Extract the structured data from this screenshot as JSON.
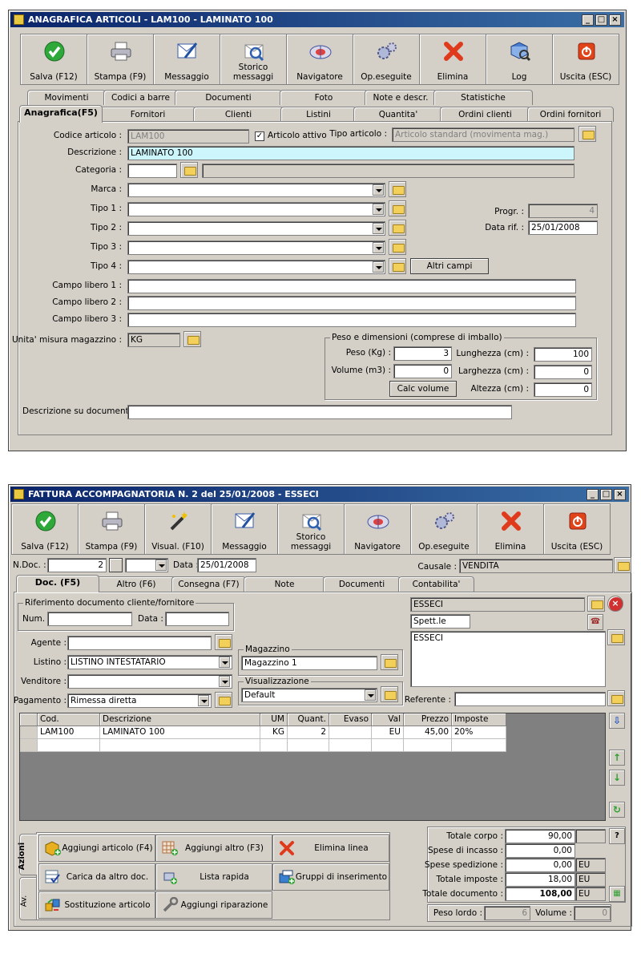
{
  "win1": {
    "title": "ANAGRAFICA ARTICOLI - LAM100 - LAMINATO 100",
    "toolbar": [
      {
        "label": "Salva (F12)",
        "icon": "check-icon"
      },
      {
        "label": "Stampa (F9)",
        "icon": "printer-icon"
      },
      {
        "label": "Messaggio",
        "icon": "message-icon"
      },
      {
        "label": "Storico messaggi",
        "icon": "message-history-icon"
      },
      {
        "label": "Navigatore",
        "icon": "navigator-icon"
      },
      {
        "label": "Op.eseguite",
        "icon": "operations-icon"
      },
      {
        "label": "Elimina",
        "icon": "delete-icon"
      },
      {
        "label": "Log",
        "icon": "log-icon"
      },
      {
        "label": "Uscita (ESC)",
        "icon": "exit-icon"
      }
    ],
    "tabs_top": [
      "Movimenti",
      "Codici a barre",
      "Documenti",
      "Foto",
      "Note e descr.",
      "Statistiche"
    ],
    "tabs_bottom": [
      "Anagrafica(F5)",
      "Fornitori",
      "Clienti",
      "Listini",
      "Quantita'",
      "Ordini clienti",
      "Ordini fornitori"
    ],
    "form": {
      "codice_label": "Codice articolo :",
      "codice_value": "LAM100",
      "attivo_label": "Articolo attivo",
      "tipo_articolo_label": "Tipo articolo :",
      "tipo_articolo_value": "Articolo standard (movimenta mag.)",
      "descrizione_label": "Descrizione :",
      "descrizione_value": "LAMINATO 100",
      "categoria_label": "Categoria :",
      "marca_label": "Marca :",
      "tipo1_label": "Tipo 1 :",
      "tipo2_label": "Tipo 2 :",
      "tipo3_label": "Tipo 3 :",
      "tipo4_label": "Tipo 4 :",
      "altri_campi": "Altri campi",
      "progr_label": "Progr. :",
      "progr_value": "4",
      "datarif_label": "Data rif. :",
      "datarif_value": "25/01/2008",
      "libero1_label": "Campo libero 1 :",
      "libero2_label": "Campo libero 2 :",
      "libero3_label": "Campo libero 3 :",
      "um_label": "Unita' misura magazzino :",
      "um_value": "KG",
      "peso_group": "Peso e dimensioni (comprese di imballo)",
      "peso_label": "Peso (Kg) :",
      "peso_value": "3",
      "volume_label": "Volume (m3) :",
      "volume_value": "0",
      "lunghezza_label": "Lunghezza (cm) :",
      "lunghezza_value": "100",
      "larghezza_label": "Larghezza (cm) :",
      "larghezza_value": "0",
      "altezza_label": "Altezza (cm) :",
      "altezza_value": "0",
      "calc_volume": "Calc volume",
      "desc_doc_label": "Descrizione su documenti:"
    }
  },
  "win2": {
    "title": "FATTURA ACCOMPAGNATORIA N. 2  del 25/01/2008 - ESSECI",
    "toolbar": [
      {
        "label": "Salva (F12)",
        "icon": "check-icon"
      },
      {
        "label": "Stampa (F9)",
        "icon": "printer-icon"
      },
      {
        "label": "Visual. (F10)",
        "icon": "magic-wand-icon"
      },
      {
        "label": "Messaggio",
        "icon": "message-icon"
      },
      {
        "label": "Storico messaggi",
        "icon": "message-history-icon"
      },
      {
        "label": "Navigatore",
        "icon": "navigator-icon"
      },
      {
        "label": "Op.eseguite",
        "icon": "operations-icon"
      },
      {
        "label": "Elimina",
        "icon": "delete-icon"
      },
      {
        "label": "Uscita (ESC)",
        "icon": "exit-icon"
      }
    ],
    "header": {
      "ndoc_label": "N.Doc. :",
      "ndoc_value": "2",
      "data_label": "Data :",
      "data_value": "25/01/2008",
      "causale_label": "Causale :",
      "causale_value": "VENDITA"
    },
    "tabs": [
      "Doc. (F5)",
      "Altro (F6)",
      "Consegna (F7)",
      "Note",
      "Documenti",
      "Contabilita'"
    ],
    "rif": {
      "group": "Riferimento documento cliente/fornitore",
      "num_label": "Num. :",
      "data_label": "Data :"
    },
    "cliente": {
      "nome": "ESSECI",
      "titolo": "Spett.le",
      "indirizzo": "ESSECI",
      "referente_label": "Referente :"
    },
    "fields": {
      "agente_label": "Agente :",
      "listino_label": "Listino :",
      "listino_value": "LISTINO INTESTATARIO",
      "venditore_label": "Venditore :",
      "pagamento_label": "Pagamento :",
      "pagamento_value": "Rimessa diretta",
      "magazzino_group": "Magazzino",
      "magazzino_value": "Magazzino 1",
      "visual_group": "Visualizzazione",
      "visual_value": "Default"
    },
    "grid": {
      "columns": [
        "Cod.",
        "Descrizione",
        "UM",
        "Quant.",
        "Evaso",
        "Val",
        "Prezzo",
        "Imposte"
      ],
      "rows": [
        [
          "LAM100",
          "LAMINATO 100",
          "KG",
          "2",
          "",
          "EU",
          "45,00",
          "20%"
        ]
      ]
    },
    "side_tabs": [
      "Azioni",
      "Av."
    ],
    "actions": [
      {
        "label": "Aggiungi articolo (F4)",
        "icon": "add-article-icon"
      },
      {
        "label": "Aggiungi altro (F3)",
        "icon": "add-other-icon"
      },
      {
        "label": "Elimina linea",
        "icon": "delete-line-icon"
      },
      {
        "label": "Carica da altro doc.",
        "icon": "load-doc-icon"
      },
      {
        "label": "Lista rapida",
        "icon": "quick-list-icon"
      },
      {
        "label": "Gruppi di inserimento",
        "icon": "insert-groups-icon"
      },
      {
        "label": "Sostituzione articolo",
        "icon": "replace-article-icon"
      },
      {
        "label": "Aggiungi riparazione",
        "icon": "repair-icon"
      }
    ],
    "totals": {
      "corpo_label": "Totale corpo :",
      "corpo_value": "90,00",
      "help": "?",
      "incasso_label": "Spese di incasso :",
      "incasso_value": "0,00",
      "spedizione_label": "Spese spedizione :",
      "spedizione_value": "0,00",
      "spedizione_val": "EU",
      "imposte_label": "Totale imposte :",
      "imposte_value": "18,00",
      "imposte_val": "EU",
      "documento_label": "Totale documento :",
      "documento_value": "108,00",
      "documento_val": "EU",
      "peso_label": "Peso lordo :",
      "peso_value": "6",
      "volume_label": "Volume :",
      "volume_value": "0"
    }
  }
}
